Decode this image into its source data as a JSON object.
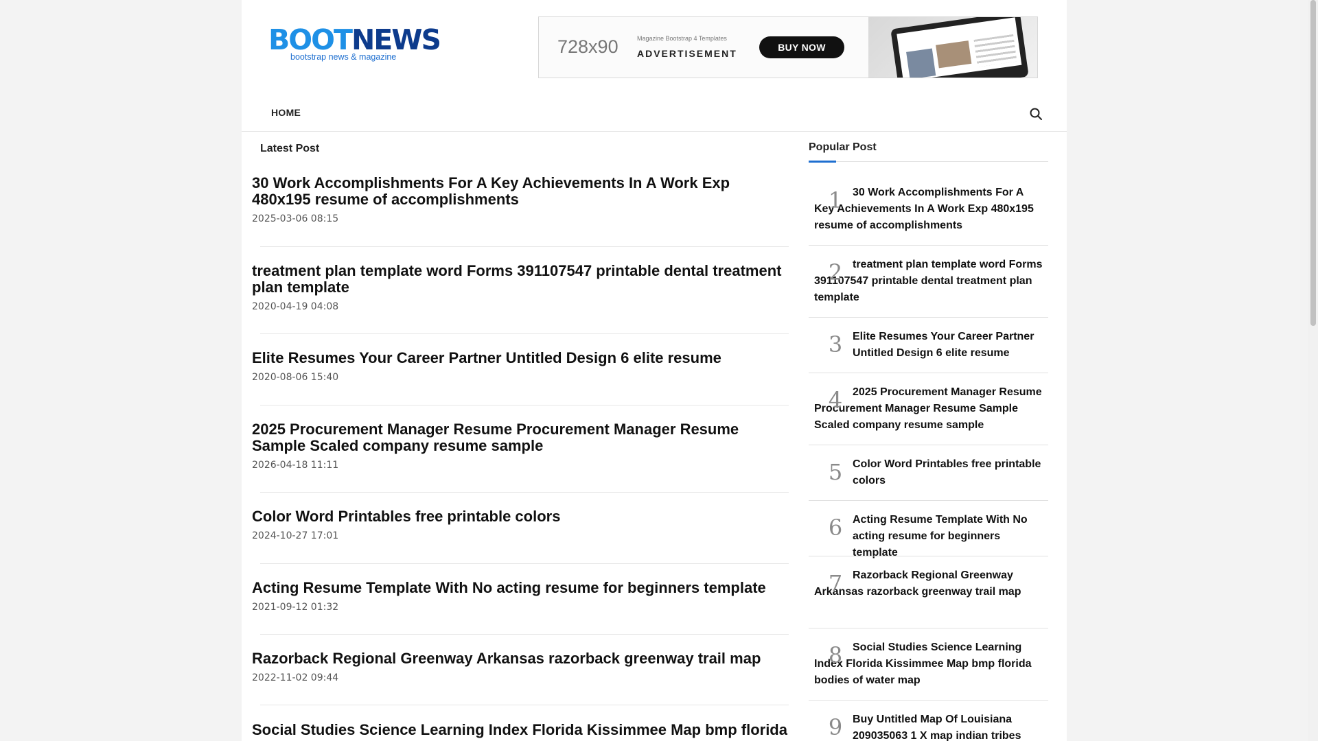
{
  "header": {
    "logo_boot": "BOOT",
    "logo_news": "NEWS",
    "logo_tagline": "bootstrap news & magazine",
    "ad": {
      "size": "728x90",
      "small_text": "Magazine Bootstrap 4 Templates",
      "label": "ADVERTISEMENT",
      "button": "BUY NOW"
    }
  },
  "nav": {
    "home": "HOME",
    "search_icon": "search-icon"
  },
  "latest": {
    "title": "Latest Post",
    "posts": [
      {
        "title": "30 Work Accomplishments For A Key Achievements In A Work Exp 480x195 resume of accomplishments",
        "date": "2025-03-06 08:15"
      },
      {
        "title": "treatment plan template word Forms 391107547 printable dental treatment plan template",
        "date": "2020-04-19 04:08"
      },
      {
        "title": "Elite Resumes Your Career Partner Untitled Design 6 elite resume",
        "date": "2020-08-06 15:40"
      },
      {
        "title": "2025 Procurement Manager Resume Procurement Manager Resume Sample Scaled company resume sample",
        "date": "2026-04-18 11:11"
      },
      {
        "title": "Color Word Printables free printable colors",
        "date": "2024-10-27 17:01"
      },
      {
        "title": "Acting Resume Template With No acting resume for beginners template",
        "date": "2021-09-12 01:32"
      },
      {
        "title": "Razorback Regional Greenway Arkansas razorback greenway trail map",
        "date": "2022-11-02 09:44"
      },
      {
        "title": "Social Studies Science Learning Index Florida Kissimmee Map bmp florida",
        "date": ""
      }
    ]
  },
  "popular": {
    "title": "Popular Post",
    "items": [
      {
        "num": "1",
        "title": "30 Work Accomplishments For A Key Achievements In A Work Exp 480x195 resume of accomplishments"
      },
      {
        "num": "2",
        "title": "treatment plan template word Forms 391107547 printable dental treatment plan template"
      },
      {
        "num": "3",
        "title": "Elite Resumes Your Career Partner Untitled Design 6 elite resume"
      },
      {
        "num": "4",
        "title": "2025 Procurement Manager Resume Procurement Manager Resume Sample Scaled company resume sample"
      },
      {
        "num": "5",
        "title": "Color Word Printables free printable colors"
      },
      {
        "num": "6",
        "title": "Acting Resume Template With No acting resume for beginners template"
      },
      {
        "num": "7",
        "title": "Razorback Regional Greenway Arkansas razorback greenway trail map"
      },
      {
        "num": "8",
        "title": "Social Studies Science Learning Index Florida Kissimmee Map bmp florida bodies of water map"
      },
      {
        "num": "9",
        "title": "Buy Untitled Map Of Louisiana 209035063 1 X map indian tribes"
      }
    ]
  },
  "colors": {
    "accent": "#1e6fd0",
    "logo_boot": "#1e90e6",
    "logo_news": "#0d3b8c"
  }
}
